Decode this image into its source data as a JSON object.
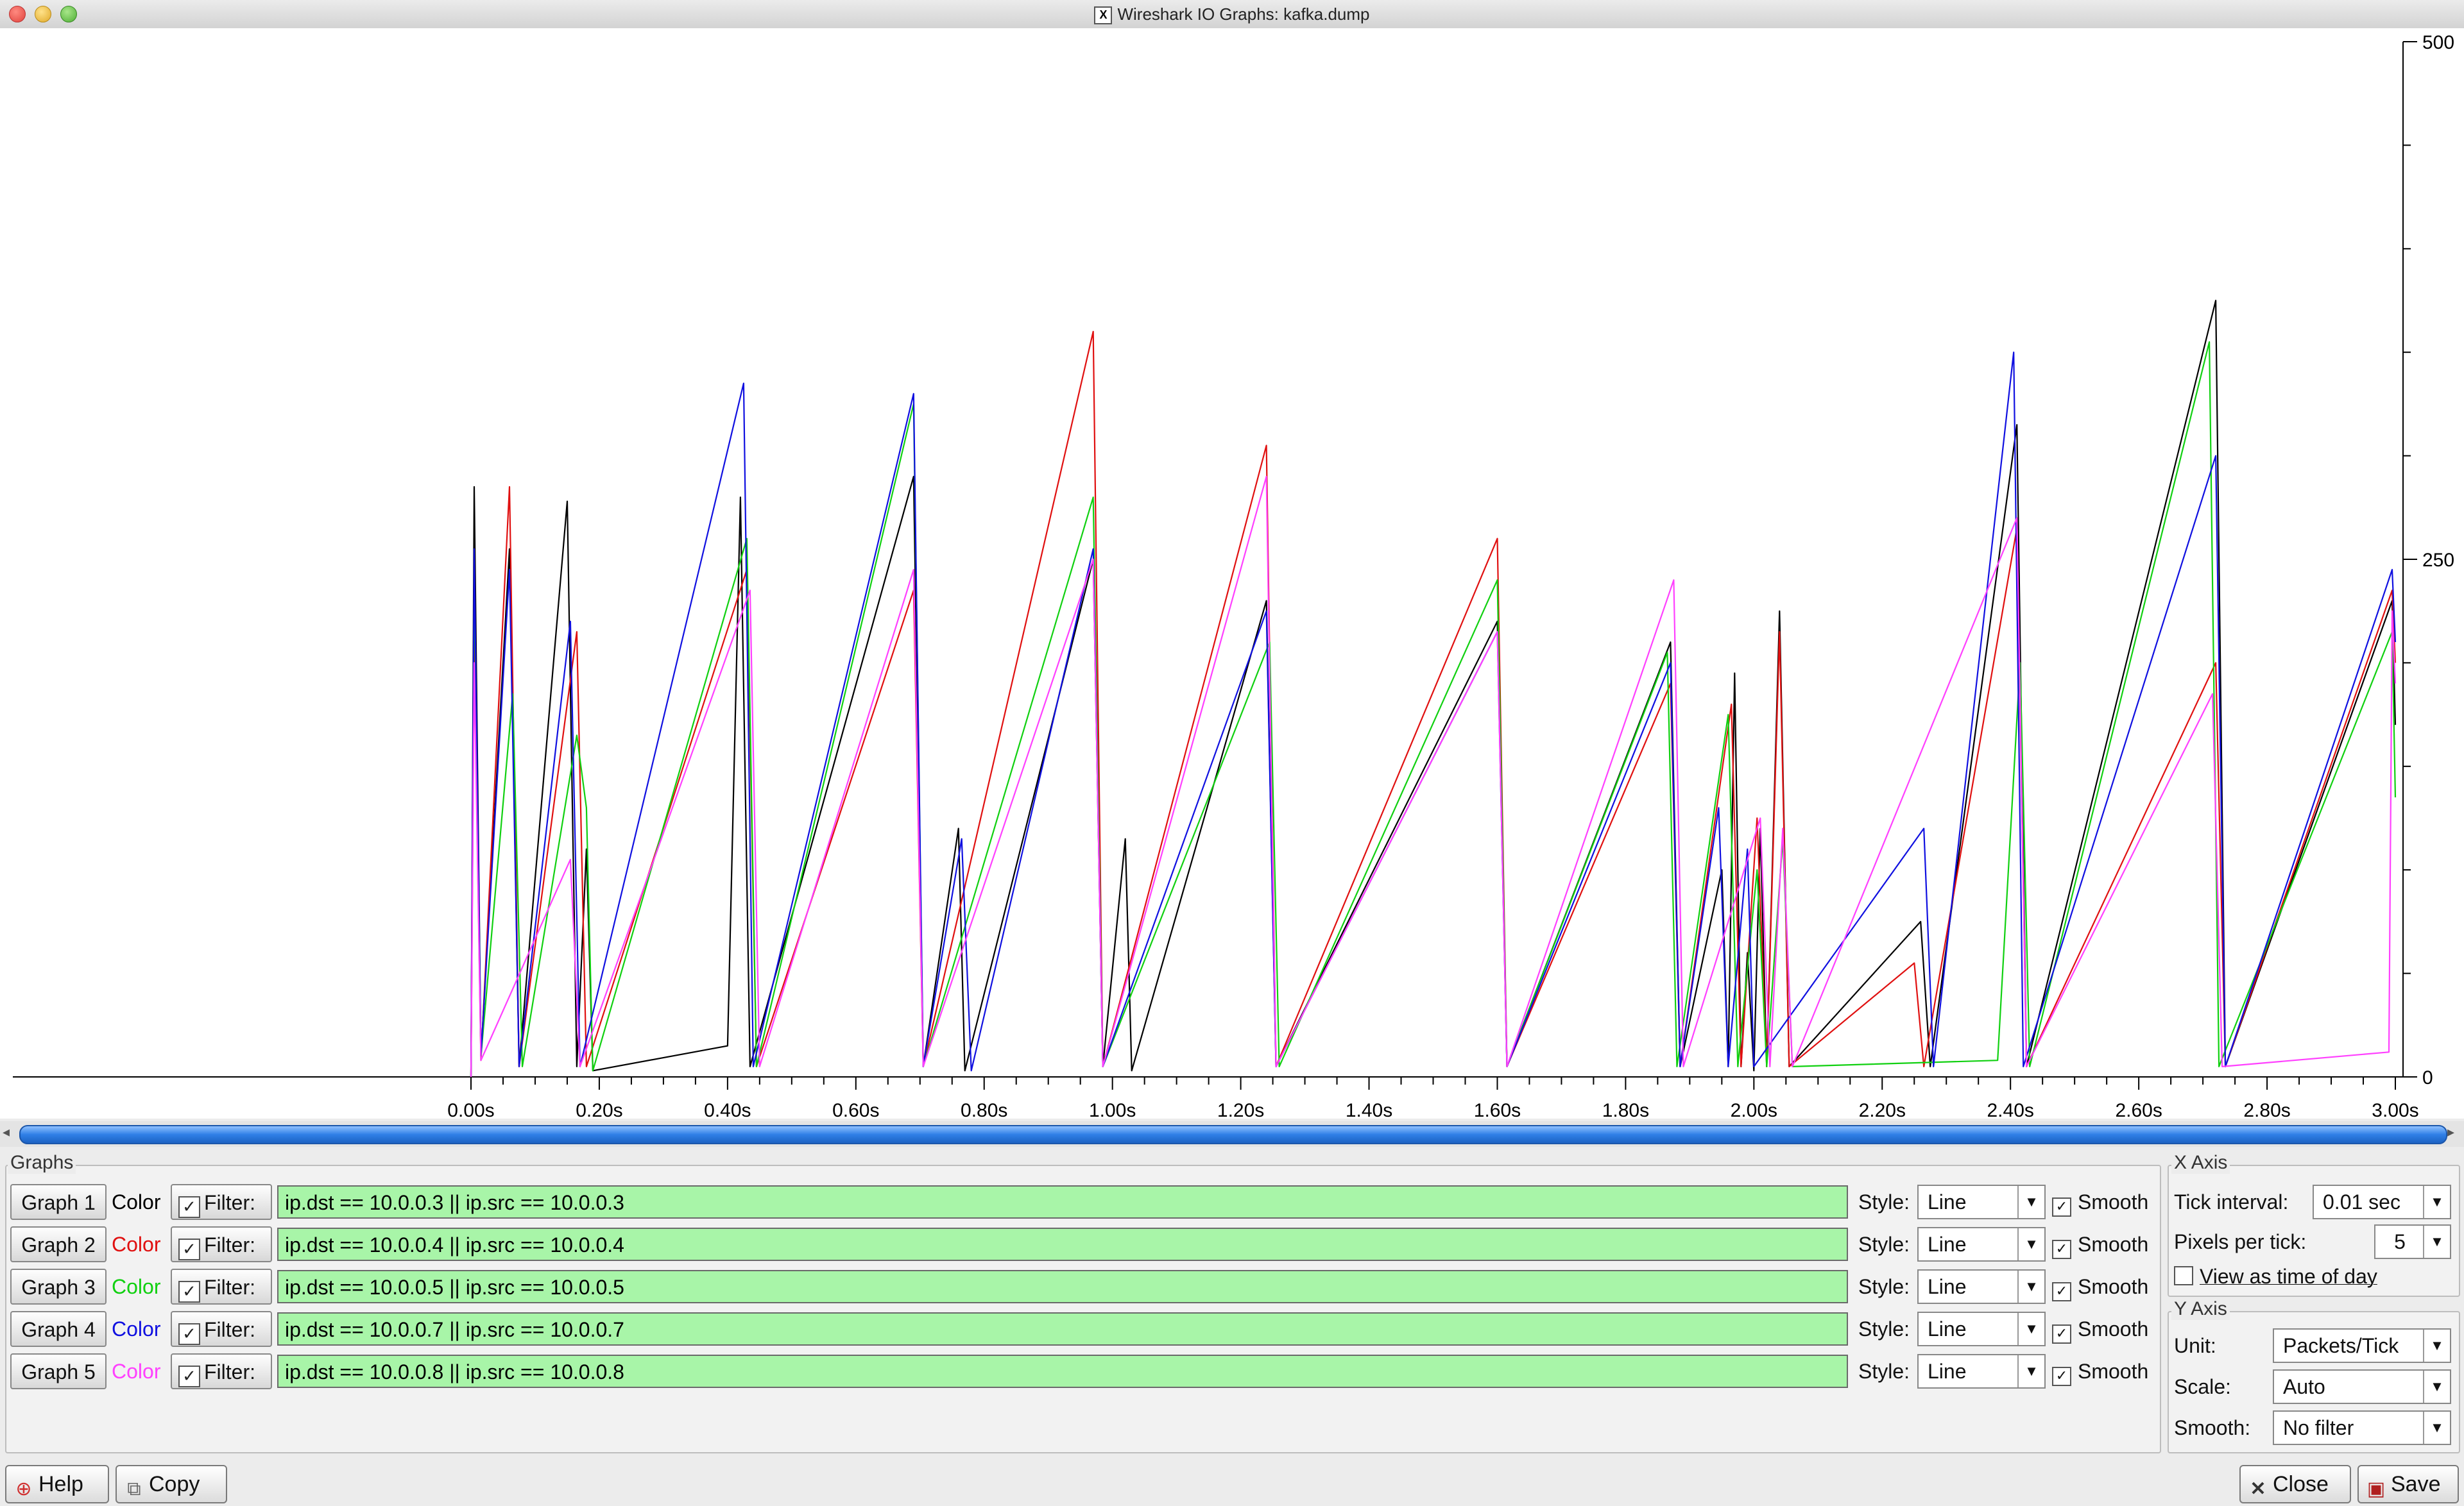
{
  "window": {
    "title": "Wireshark IO Graphs: kafka.dump",
    "title_icon": "X"
  },
  "chart_data": {
    "type": "line",
    "x_tick_labels": [
      "0.00s",
      "0.20s",
      "0.40s",
      "0.60s",
      "0.80s",
      "1.00s",
      "1.20s",
      "1.40s",
      "1.60s",
      "1.80s",
      "2.00s",
      "2.20s",
      "2.40s",
      "2.60s",
      "2.80s",
      "3.00s"
    ],
    "y_tick_labels": [
      "500",
      "250",
      "0"
    ],
    "xlim": [
      0,
      3.0
    ],
    "ylim": [
      0,
      500
    ],
    "series": [
      {
        "color": "#000000",
        "values": [
          [
            0.005,
            285
          ],
          [
            0.0155,
            10
          ],
          [
            0.06,
            255
          ],
          [
            0.075,
            5
          ],
          [
            0.15,
            278
          ],
          [
            0.165,
            5
          ],
          [
            0.18,
            110
          ],
          [
            0.19,
            3
          ],
          [
            0.4,
            15
          ],
          [
            0.42,
            280
          ],
          [
            0.435,
            5
          ],
          [
            0.69,
            290
          ],
          [
            0.705,
            5
          ],
          [
            0.76,
            120
          ],
          [
            0.77,
            3
          ],
          [
            0.97,
            250
          ],
          [
            0.985,
            5
          ],
          [
            1.02,
            115
          ],
          [
            1.03,
            3
          ],
          [
            1.24,
            230
          ],
          [
            1.255,
            5
          ],
          [
            1.6,
            220
          ],
          [
            1.615,
            5
          ],
          [
            1.87,
            210
          ],
          [
            1.885,
            5
          ],
          [
            1.95,
            100
          ],
          [
            1.96,
            5
          ],
          [
            1.97,
            195
          ],
          [
            1.98,
            5
          ],
          [
            1.99,
            60
          ],
          [
            2.0,
            3
          ],
          [
            2.01,
            120
          ],
          [
            2.02,
            5
          ],
          [
            2.04,
            225
          ],
          [
            2.055,
            5
          ],
          [
            2.26,
            75
          ],
          [
            2.275,
            5
          ],
          [
            2.41,
            315
          ],
          [
            2.425,
            5
          ],
          [
            2.72,
            375
          ],
          [
            2.735,
            5
          ],
          [
            2.995,
            230
          ],
          [
            3.0,
            170
          ]
        ]
      },
      {
        "color": "#e01010",
        "values": [
          [
            0.005,
            210
          ],
          [
            0.0155,
            8
          ],
          [
            0.06,
            285
          ],
          [
            0.075,
            5
          ],
          [
            0.165,
            215
          ],
          [
            0.18,
            5
          ],
          [
            0.43,
            245
          ],
          [
            0.445,
            5
          ],
          [
            0.69,
            235
          ],
          [
            0.705,
            5
          ],
          [
            0.97,
            360
          ],
          [
            0.985,
            5
          ],
          [
            1.24,
            305
          ],
          [
            1.255,
            5
          ],
          [
            1.6,
            260
          ],
          [
            1.615,
            5
          ],
          [
            1.87,
            190
          ],
          [
            1.885,
            5
          ],
          [
            1.965,
            180
          ],
          [
            1.98,
            5
          ],
          [
            2.005,
            125
          ],
          [
            2.02,
            5
          ],
          [
            2.04,
            215
          ],
          [
            2.055,
            5
          ],
          [
            2.25,
            55
          ],
          [
            2.265,
            5
          ],
          [
            2.41,
            265
          ],
          [
            2.425,
            5
          ],
          [
            2.72,
            200
          ],
          [
            2.735,
            5
          ],
          [
            2.995,
            235
          ],
          [
            3.0,
            200
          ]
        ]
      },
      {
        "color": "#10d010",
        "values": [
          [
            0.005,
            245
          ],
          [
            0.0155,
            10
          ],
          [
            0.065,
            185
          ],
          [
            0.08,
            5
          ],
          [
            0.165,
            165
          ],
          [
            0.18,
            130
          ],
          [
            0.19,
            3
          ],
          [
            0.43,
            260
          ],
          [
            0.445,
            5
          ],
          [
            0.69,
            325
          ],
          [
            0.705,
            5
          ],
          [
            0.97,
            280
          ],
          [
            0.985,
            5
          ],
          [
            1.245,
            210
          ],
          [
            1.26,
            5
          ],
          [
            1.6,
            240
          ],
          [
            1.615,
            5
          ],
          [
            1.865,
            205
          ],
          [
            1.88,
            5
          ],
          [
            1.96,
            175
          ],
          [
            1.975,
            5
          ],
          [
            2.005,
            100
          ],
          [
            2.02,
            5
          ],
          [
            2.045,
            115
          ],
          [
            2.06,
            5
          ],
          [
            2.38,
            8
          ],
          [
            2.415,
            200
          ],
          [
            2.43,
            5
          ],
          [
            2.71,
            355
          ],
          [
            2.725,
            5
          ],
          [
            2.995,
            215
          ],
          [
            3.0,
            135
          ]
        ]
      },
      {
        "color": "#1010e0",
        "values": [
          [
            0.005,
            255
          ],
          [
            0.0155,
            10
          ],
          [
            0.06,
            245
          ],
          [
            0.075,
            5
          ],
          [
            0.155,
            220
          ],
          [
            0.17,
            5
          ],
          [
            0.425,
            335
          ],
          [
            0.44,
            5
          ],
          [
            0.69,
            330
          ],
          [
            0.705,
            5
          ],
          [
            0.765,
            115
          ],
          [
            0.78,
            3
          ],
          [
            0.97,
            255
          ],
          [
            0.985,
            5
          ],
          [
            1.24,
            225
          ],
          [
            1.255,
            5
          ],
          [
            1.6,
            215
          ],
          [
            1.615,
            5
          ],
          [
            1.87,
            200
          ],
          [
            1.885,
            5
          ],
          [
            1.945,
            130
          ],
          [
            1.96,
            5
          ],
          [
            1.99,
            110
          ],
          [
            2.0,
            5
          ],
          [
            2.265,
            120
          ],
          [
            2.28,
            5
          ],
          [
            2.405,
            350
          ],
          [
            2.42,
            5
          ],
          [
            2.72,
            300
          ],
          [
            2.735,
            5
          ],
          [
            2.995,
            245
          ],
          [
            3.0,
            210
          ]
        ]
      },
      {
        "color": "#ff40ff",
        "values": [
          [
            0.005,
            200
          ],
          [
            0.0155,
            8
          ],
          [
            0.155,
            105
          ],
          [
            0.17,
            5
          ],
          [
            0.435,
            235
          ],
          [
            0.45,
            5
          ],
          [
            0.69,
            245
          ],
          [
            0.705,
            5
          ],
          [
            0.97,
            250
          ],
          [
            0.985,
            5
          ],
          [
            1.24,
            290
          ],
          [
            1.255,
            5
          ],
          [
            1.6,
            215
          ],
          [
            1.615,
            5
          ],
          [
            1.875,
            240
          ],
          [
            1.89,
            5
          ],
          [
            2.01,
            125
          ],
          [
            2.025,
            5
          ],
          [
            2.045,
            120
          ],
          [
            2.06,
            5
          ],
          [
            2.41,
            270
          ],
          [
            2.425,
            5
          ],
          [
            2.715,
            185
          ],
          [
            2.73,
            5
          ],
          [
            2.99,
            12
          ],
          [
            2.995,
            225
          ],
          [
            3.0,
            190
          ]
        ]
      }
    ]
  },
  "graphs_panel": {
    "legend": "Graphs",
    "rows": [
      {
        "button": "Graph 1",
        "color_label": "Color",
        "color": "#000000",
        "filter_label": "Filter:",
        "filter_value": "ip.dst == 10.0.0.3 || ip.src == 10.0.0.3",
        "style_label": "Style:",
        "style_value": "Line",
        "smooth_label": "Smooth"
      },
      {
        "button": "Graph 2",
        "color_label": "Color",
        "color": "#e01010",
        "filter_label": "Filter:",
        "filter_value": "ip.dst == 10.0.0.4 || ip.src == 10.0.0.4",
        "style_label": "Style:",
        "style_value": "Line",
        "smooth_label": "Smooth"
      },
      {
        "button": "Graph 3",
        "color_label": "Color",
        "color": "#10d010",
        "filter_label": "Filter:",
        "filter_value": "ip.dst == 10.0.0.5 || ip.src == 10.0.0.5",
        "style_label": "Style:",
        "style_value": "Line",
        "smooth_label": "Smooth"
      },
      {
        "button": "Graph 4",
        "color_label": "Color",
        "color": "#1010e0",
        "filter_label": "Filter:",
        "filter_value": "ip.dst == 10.0.0.7 || ip.src == 10.0.0.7",
        "style_label": "Style:",
        "style_value": "Line",
        "smooth_label": "Smooth"
      },
      {
        "button": "Graph 5",
        "color_label": "Color",
        "color": "#ff40ff",
        "filter_label": "Filter:",
        "filter_value": "ip.dst == 10.0.0.8 || ip.src == 10.0.0.8",
        "style_label": "Style:",
        "style_value": "Line",
        "smooth_label": "Smooth"
      }
    ]
  },
  "x_axis": {
    "legend": "X Axis",
    "tick_interval_label": "Tick interval:",
    "tick_interval_value": "0.01 sec",
    "pixels_per_tick_label": "Pixels per tick:",
    "pixels_per_tick_value": "5",
    "time_of_day_label": "View as time of day"
  },
  "y_axis": {
    "legend": "Y Axis",
    "unit_label": "Unit:",
    "unit_value": "Packets/Tick",
    "scale_label": "Scale:",
    "scale_value": "Auto",
    "smooth_label": "Smooth:",
    "smooth_value": "No filter"
  },
  "buttons": {
    "help": "Help",
    "copy": "Copy",
    "close": "Close",
    "save": "Save"
  }
}
